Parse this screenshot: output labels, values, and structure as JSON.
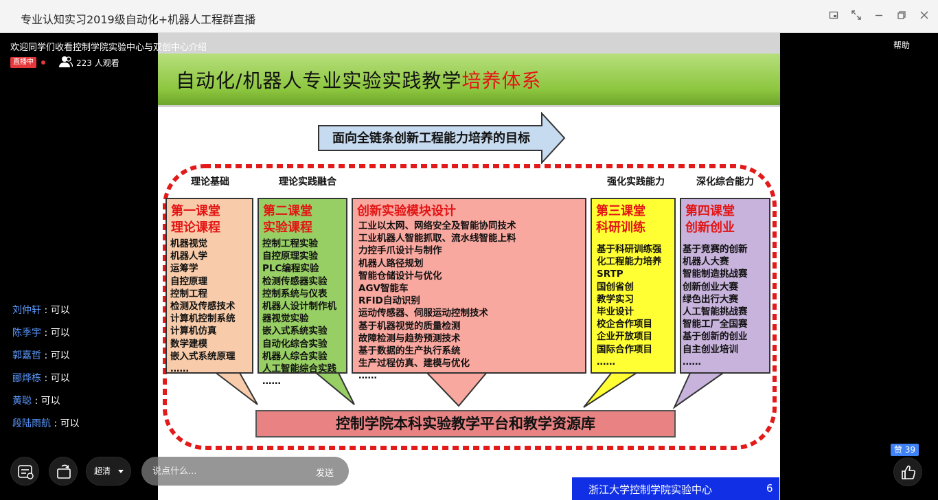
{
  "window": {
    "title": "专业认知实习2019级自动化+机器人工程群直播"
  },
  "live": {
    "title": "欢迎同学们收看控制学院实验中心与双创中心介绍",
    "badge": "直播中",
    "viewers": "223 人观看",
    "help": "帮助"
  },
  "slide": {
    "heading_main": "自动化/机器人专业实验实践教学",
    "heading_highlight": "培养体系",
    "goal": "面向全链条创新工程能力培养的目标",
    "categories": [
      "理论基础",
      "理论实践融合",
      "强化实践能力",
      "深化综合能力"
    ],
    "boxes": [
      {
        "title": [
          "第一课堂",
          "理论课程"
        ],
        "items": [
          "机器视觉",
          "机器人学",
          "运筹学",
          "自控原理",
          "控制工程",
          "检测及传感技术",
          "计算机控制系统",
          "计算机仿真",
          "数学建模",
          "嵌入式系统原理",
          "……"
        ]
      },
      {
        "title": [
          "第二课堂",
          "实验课程"
        ],
        "items": [
          "控制工程实验",
          "自控原理实验",
          "PLC编程实验",
          "检测传感器实验",
          "控制系统与仪表",
          "机器人设计制作机",
          "器视觉实验",
          "嵌入式系统实验",
          "自动化综合实验",
          "机器人综合实验",
          "人工智能综合实践",
          "……"
        ]
      },
      {
        "title": [
          "创新实验模块设计"
        ],
        "items": [
          "工业以太网、网络安全及智能协同技术",
          "工业机器人智能抓取、流水线智能上料",
          "力控手爪设计与制作",
          "机器人路径规划",
          "智能仓储设计与优化",
          "AGV智能车",
          "RFID自动识别",
          "运动传感器、伺服运动控制技术",
          "基于机器视觉的质量检测",
          "故障检测与趋势预测技术",
          "基于数据的生产执行系统",
          "生产过程仿真、建模与优化",
          "……"
        ]
      },
      {
        "title": [
          "第三课堂",
          "科研训练"
        ],
        "items": [
          "基于科研训练强",
          "化工程能力培养",
          "SRTP",
          "国创省创",
          "教学实习",
          "毕业设计",
          "校企合作项目",
          "企业开放项目",
          "国际合作项目",
          "……"
        ]
      },
      {
        "title": [
          "第四课堂",
          "创新创业"
        ],
        "items": [
          "基于竞赛的创新",
          "机器人大赛",
          "智能制造挑战赛",
          "创新创业大赛",
          "绿色出行大赛",
          "人工智能挑战赛",
          "智能工厂全国赛",
          "基于创新的创业",
          "自主创业培训",
          "……"
        ]
      }
    ],
    "base": "控制学院本科实验教学平台和教学资源库",
    "footer": "浙江大学控制学院实验中心",
    "page": "6"
  },
  "chat": [
    {
      "name": "刘仲轩",
      "sep": " : ",
      "msg": "可以"
    },
    {
      "name": "陈季宇",
      "sep": " : ",
      "msg": "可以"
    },
    {
      "name": "郭嘉哲",
      "sep": " : ",
      "msg": "可以"
    },
    {
      "name": "郦烨栋",
      "sep": " : ",
      "msg": "可以"
    },
    {
      "name": "黄聪",
      "sep": " : ",
      "msg": "可以"
    },
    {
      "name": "段陆雨航",
      "sep": " : ",
      "msg": "可以"
    }
  ],
  "controls": {
    "quality": "超清",
    "comment_placeholder": "说点什么...",
    "send": "发送",
    "likes": "赞 39"
  },
  "colors": {
    "live_red": "#e4393c",
    "chat_name": "#5b9aff",
    "like_blue": "#3e82f7",
    "slide_green": "#8dc63f",
    "footer_blue": "#1130e6"
  }
}
